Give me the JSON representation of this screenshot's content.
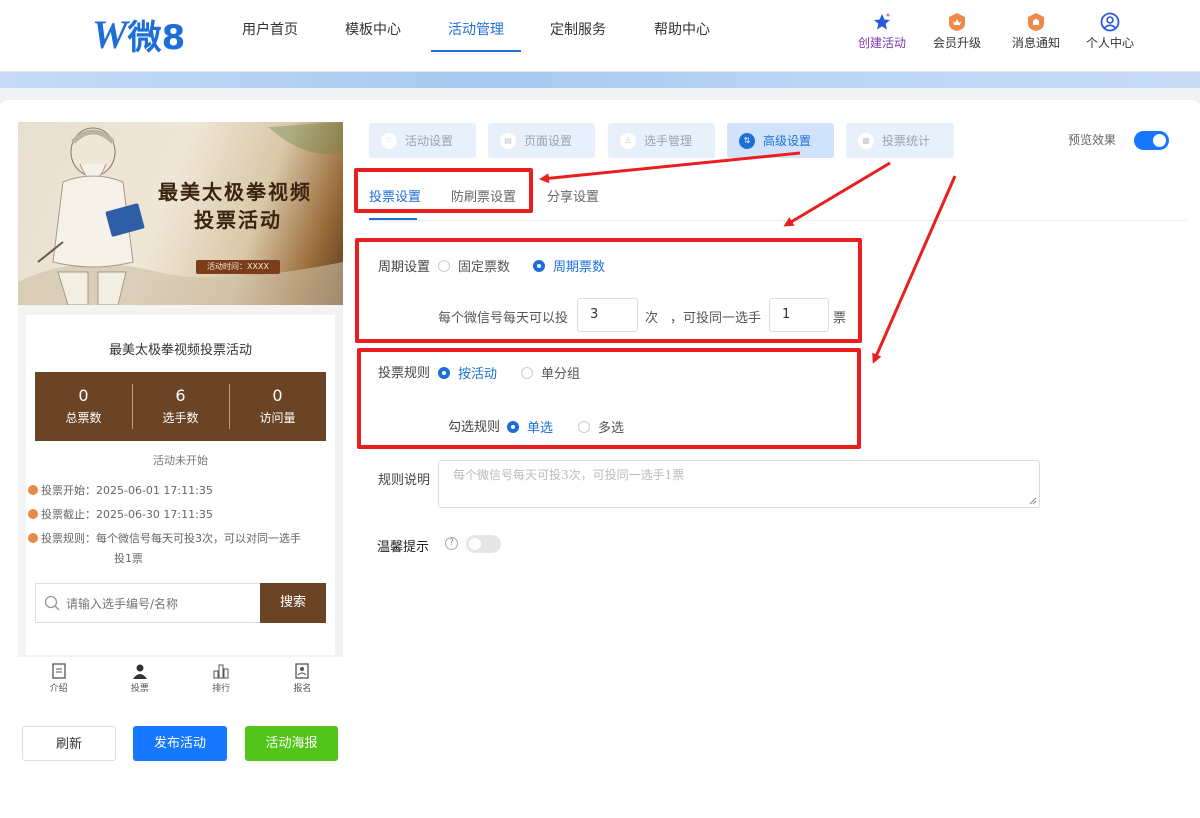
{
  "header": {
    "logo_text": "微8",
    "nav": [
      {
        "label": "用户首页"
      },
      {
        "label": "模板中心"
      },
      {
        "label": "活动管理"
      },
      {
        "label": "定制服务"
      },
      {
        "label": "帮助中心"
      }
    ],
    "tools": [
      {
        "label": "创建活动",
        "icon": "star-icon"
      },
      {
        "label": "会员升级",
        "icon": "crown-badge-icon"
      },
      {
        "label": "消息通知",
        "icon": "bell-badge-icon"
      },
      {
        "label": "个人中心",
        "icon": "user-icon"
      }
    ]
  },
  "preview": {
    "banner": {
      "title_line1": "最美太极拳视频",
      "title_line2": "投票活动",
      "time": "活动时间：XXXX"
    },
    "activity_title": "最美太极拳视频投票活动",
    "stats": [
      {
        "value": "0",
        "label": "总票数"
      },
      {
        "value": "6",
        "label": "选手数"
      },
      {
        "value": "0",
        "label": "访问量"
      }
    ],
    "status": "活动未开始",
    "rules": [
      "投票开始：2025-06-01 17:11:35",
      "投票截止：2025-06-30 17:11:35",
      "投票规则：每个微信号每天可投3次，可以对同一选手",
      "投1票"
    ],
    "search": {
      "placeholder": "请输入选手编号/名称",
      "button": "搜索"
    },
    "tabs": [
      {
        "label": "介绍"
      },
      {
        "label": "投票"
      },
      {
        "label": "排行"
      },
      {
        "label": "报名"
      }
    ],
    "buttons": {
      "refresh": "刷新",
      "publish": "发布活动",
      "poster": "活动海报"
    }
  },
  "steps": [
    {
      "label": "活动设置"
    },
    {
      "label": "页面设置"
    },
    {
      "label": "选手管理"
    },
    {
      "label": "高级设置"
    },
    {
      "label": "投票统计"
    }
  ],
  "preview_toggle": {
    "label": "预览效果",
    "on": true
  },
  "subtabs": [
    {
      "label": "投票设置"
    },
    {
      "label": "防刷票设置"
    },
    {
      "label": "分享设置"
    }
  ],
  "form": {
    "period": {
      "label": "周期设置",
      "options": [
        "固定票数",
        "周期票数"
      ],
      "selected": "周期票数",
      "per_day_prefix": "每个微信号每天可以投",
      "per_day_value": "3",
      "per_day_unit": "次",
      "same_prefix": "，可投同一选手",
      "same_value": "1",
      "same_unit": "票"
    },
    "vote_rule": {
      "label": "投票规则",
      "options": [
        "按活动",
        "单分组"
      ],
      "selected": "按活动"
    },
    "check_rule": {
      "label": "勾选规则",
      "options": [
        "单选",
        "多选"
      ],
      "selected": "单选"
    },
    "rule_desc": {
      "label": "规则说明",
      "placeholder": "每个微信号每天可投3次，可投同一选手1票"
    },
    "tip": {
      "label": "温馨提示",
      "on": false
    }
  },
  "colors": {
    "accent": "#1d6fd8",
    "brown": "#6b4325",
    "highlight_red": "#ea1e1e",
    "publish_blue": "#1677ff",
    "poster_green": "#52c41a"
  }
}
